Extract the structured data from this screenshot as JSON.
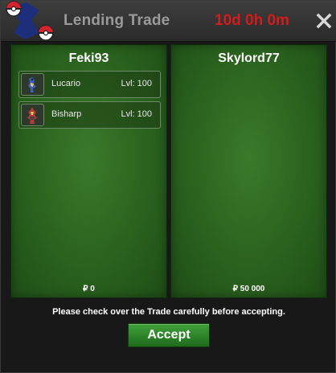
{
  "window": {
    "title": "Lending Trade",
    "timer": "10d 0h 0m",
    "close_icon": "close-x-icon"
  },
  "left_panel": {
    "player": "Feki93",
    "pokemon": [
      {
        "name": "Lucario",
        "level": "Lvl: 100",
        "icon": "lucario-sprite-icon"
      },
      {
        "name": "Bisharp",
        "level": "Lvl: 100",
        "icon": "bisharp-sprite-icon"
      }
    ],
    "money": "₽ 0"
  },
  "right_panel": {
    "player": "Skylord77",
    "pokemon": [],
    "money": "₽ 50 000"
  },
  "footer": {
    "notice": "Please check over the Trade carefully before accepting.",
    "accept_label": "Accept"
  },
  "colors": {
    "timer": "#d21c1c",
    "panel_green": "#2a621e",
    "button_green": "#2f8a2a"
  }
}
